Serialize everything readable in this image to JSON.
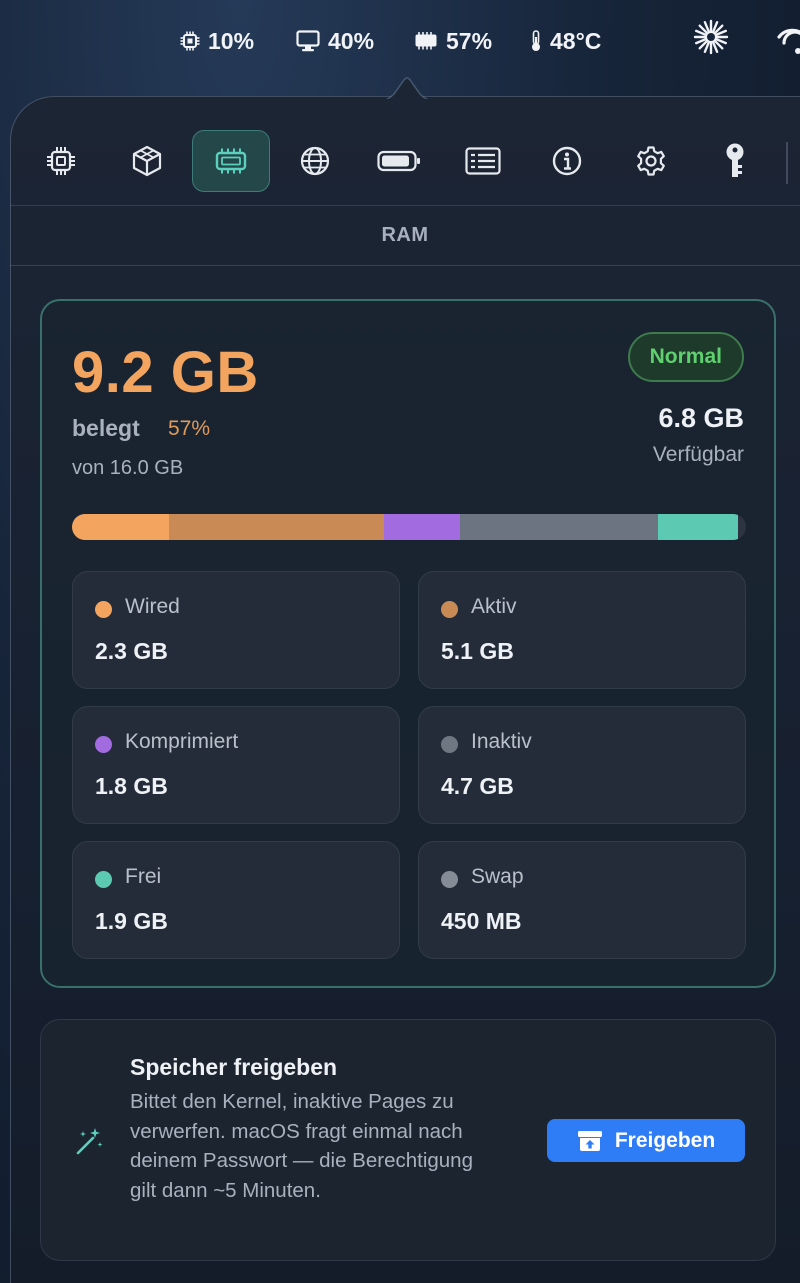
{
  "menubar": {
    "cpu_value": "10%",
    "display_value": "40%",
    "ram_value": "57%",
    "temp_value": "48°C"
  },
  "tabs": [
    {
      "id": "cpu",
      "icon": "cpu-chip-icon"
    },
    {
      "id": "gpu",
      "icon": "cube-icon"
    },
    {
      "id": "ram",
      "icon": "memory-chip-icon",
      "active": true
    },
    {
      "id": "network",
      "icon": "globe-icon"
    },
    {
      "id": "battery",
      "icon": "battery-icon"
    },
    {
      "id": "processes",
      "icon": "list-window-icon"
    },
    {
      "id": "info",
      "icon": "info-icon"
    },
    {
      "id": "settings",
      "icon": "gear-icon"
    },
    {
      "id": "key",
      "icon": "key-icon"
    }
  ],
  "section": {
    "title": "RAM"
  },
  "ram": {
    "used": "9.2 GB",
    "used_label": "belegt",
    "used_percent": "57%",
    "total": "von 16.0 GB",
    "status": "Normal",
    "available_value": "6.8 GB",
    "available_label": "Verfügbar",
    "bar_segments": [
      {
        "name": "Wired",
        "gb": 2.3,
        "color": "#f3a45e"
      },
      {
        "name": "Aktiv",
        "gb": 5.1,
        "color": "#c98a56"
      },
      {
        "name": "Komprimiert",
        "gb": 1.8,
        "color": "#a26be0"
      },
      {
        "name": "Inaktiv",
        "gb": 4.7,
        "color": "#6b7480"
      },
      {
        "name": "Frei",
        "gb": 1.9,
        "color": "#5cc9b3"
      }
    ],
    "bar_total_gb": 16.0,
    "tiles": [
      {
        "label": "Wired",
        "value": "2.3 GB",
        "color": "#f3a45e"
      },
      {
        "label": "Aktiv",
        "value": "5.1 GB",
        "color": "#c98a56"
      },
      {
        "label": "Komprimiert",
        "value": "1.8 GB",
        "color": "#a26be0"
      },
      {
        "label": "Inaktiv",
        "value": "4.7 GB",
        "color": "#6e7782"
      },
      {
        "label": "Frei",
        "value": "1.9 GB",
        "color": "#5cc9b3"
      },
      {
        "label": "Swap",
        "value": "450 MB",
        "color": "#858c96"
      }
    ]
  },
  "free_memory": {
    "title": "Speicher freigeben",
    "description": "Bittet den Kernel, inaktive Pages zu verwerfen. macOS fragt einmal nach deinem Passwort — die Berechtigung gilt dann ~5 Minuten.",
    "button_label": "Freigeben",
    "button_color": "#2f7df6"
  }
}
